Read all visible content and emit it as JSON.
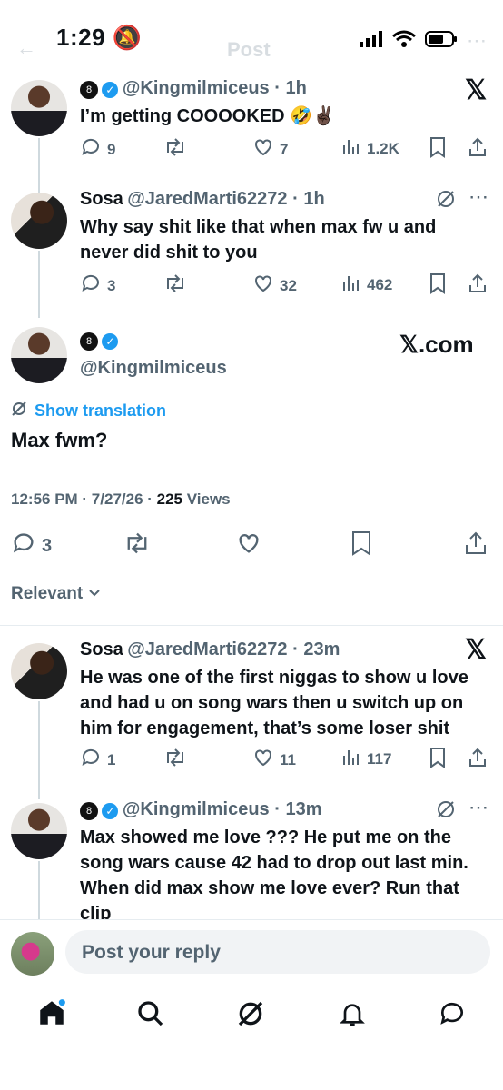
{
  "status": {
    "time": "1:29"
  },
  "header_ghost": {
    "back": "←",
    "title": "Post"
  },
  "tweet1": {
    "handle": "@Kingmilmiceus",
    "time": "1h",
    "text": "I’m getting COOOOKED 🤣✌🏿",
    "replies": "9",
    "likes": "7",
    "views": "1.2K"
  },
  "tweet2": {
    "name": "Sosa",
    "handle": "@JaredMarti62272",
    "time": "1h",
    "text": "Why say shit like that when max fw u and never did shit to you",
    "replies": "3",
    "likes": "32",
    "views": "462"
  },
  "main_post": {
    "handle": "@Kingmilmiceus",
    "xcom": "𝕏.com",
    "show_translation": "Show translation",
    "text": "Max fwm?",
    "timestamp": "12:56 PM · 7/27/26 · ",
    "views_count": "225",
    "views_label": " Views",
    "replies": "3"
  },
  "sort": {
    "label": "Relevant"
  },
  "reply1": {
    "name": "Sosa",
    "handle": "@JaredMarti62272",
    "time": "23m",
    "text": "He was one of the first niggas to show u love and had u on song wars then u switch up on him for engagement, that’s some loser shit",
    "replies": "1",
    "likes": "11",
    "views": "117"
  },
  "reply2": {
    "handle": "@Kingmilmiceus",
    "time": "13m",
    "text": "Max showed me love ??? He put me on the song wars cause 42 had to drop out last min. When did max show me love ever? Run that clip"
  },
  "composer": {
    "placeholder": "Post your reply"
  },
  "icons": {
    "reply": "speech-bubble-icon",
    "repost": "repost-icon",
    "like": "heart-icon",
    "views": "bar-chart-icon",
    "bookmark": "bookmark-icon",
    "share": "share-icon",
    "grok": "grok-icon",
    "more": "more-icon",
    "x_logo": "x-logo-icon"
  },
  "colors": {
    "accent": "#1d9bf0",
    "muted": "#536471",
    "text": "#0f1419"
  }
}
